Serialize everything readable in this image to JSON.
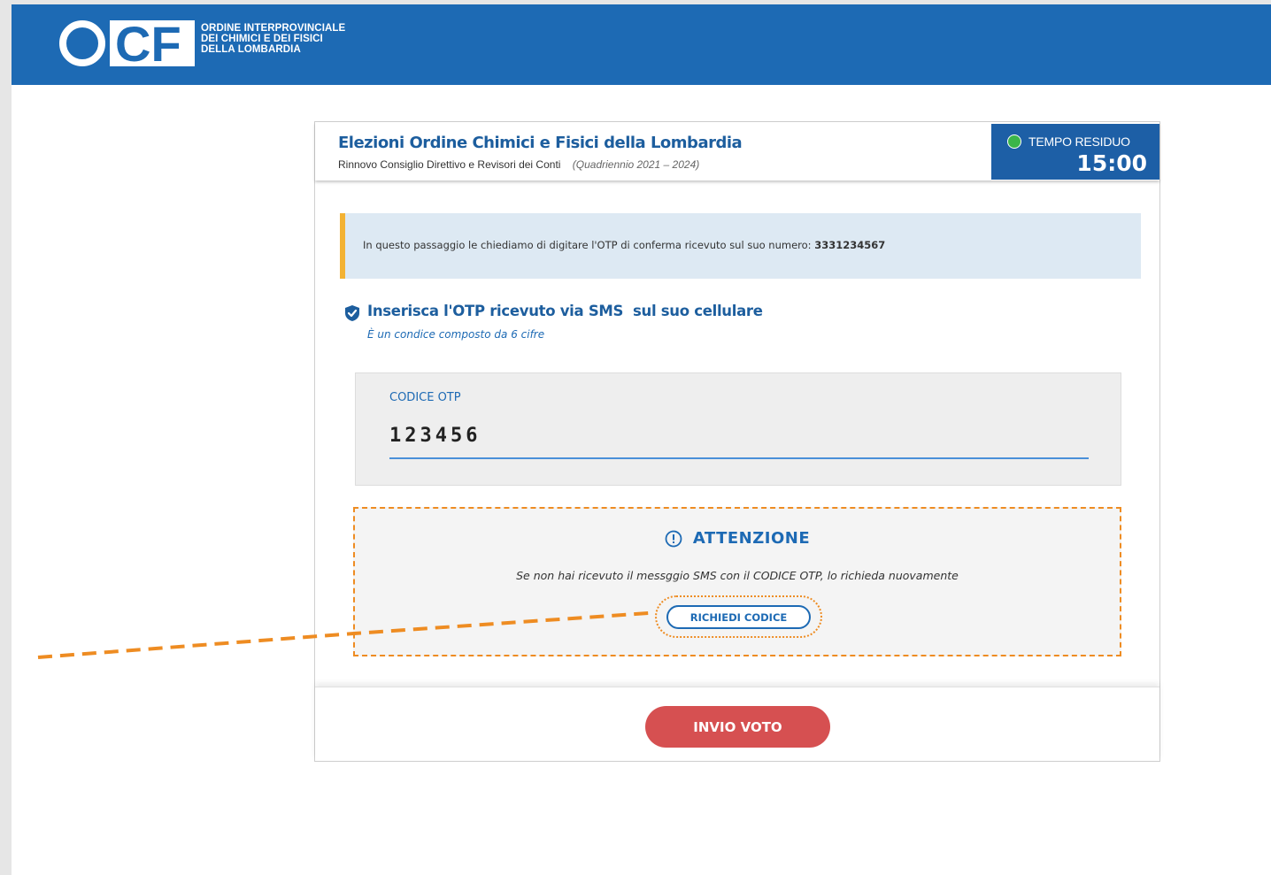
{
  "header": {
    "logo_text": "OCF",
    "org_lines": [
      "ORDINE INTERPROVINCIALE",
      "DEI CHIMICI E DEI FISICI",
      "DELLA LOMBARDIA"
    ]
  },
  "election": {
    "title": "Elezioni Ordine Chimici e Fisici della Lombardia",
    "subtitle": "Rinnovo Consiglio Direttivo e Revisori dei Conti",
    "period": "(Quadriennio 2021 – 2024)"
  },
  "timer": {
    "label": "TEMPO RESIDUO",
    "value": "15:00",
    "status_color": "#3bb54a"
  },
  "notice": {
    "text": "In questo passaggio le chiediamo di digitare l'OTP  di conferma ricevuto sul suo numero: ",
    "phone": "3331234567"
  },
  "otp": {
    "heading": "Inserisca l'OTP ricevuto via SMS  sul suo cellulare",
    "hint": "È un condice composto da 6 cifre",
    "field_label": "CODICE OTP",
    "value": "123456"
  },
  "attention": {
    "title": "ATTENZIONE",
    "text": "Se non hai ricevuto il messggio SMS con il CODICE OTP, lo richieda nuovamente",
    "request_button": "RICHIEDI CODICE"
  },
  "footer": {
    "submit_button": "INVIO VOTO"
  },
  "icons": {
    "timer_status": "status-dot-icon",
    "otp_check": "shield-check-icon",
    "attention": "info-circle-icon"
  },
  "colors": {
    "brand_blue": "#1d6ab4",
    "accent_orange": "#ee8c22",
    "notice_border": "#f3b233",
    "submit_red": "#d65051"
  }
}
